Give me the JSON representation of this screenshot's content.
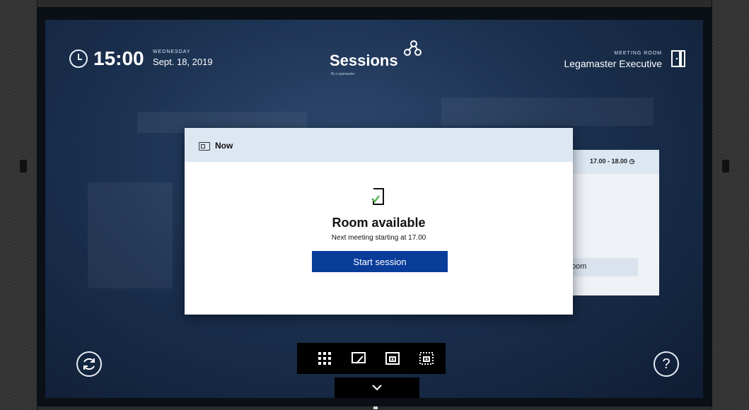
{
  "header": {
    "time": "15:00",
    "day": "WEDNESDAY",
    "date": "Sept. 18, 2019",
    "brand": "Sessions",
    "brand_sub": "By Legamaster",
    "room_label": "MEETING ROOM",
    "room_name": "Legamaster Executive"
  },
  "background_card": {
    "time_range": "17.00 - 18.00",
    "button_fragment": "oom"
  },
  "modal": {
    "header_label": "Now",
    "title": "Room available",
    "subtitle": "Next meeting starting at 17.00",
    "button_label": "Start session"
  },
  "footer": {
    "help_label": "?",
    "tools": [
      "apps-grid-icon",
      "whiteboard-icon",
      "screenshot-icon",
      "area-capture-icon"
    ]
  },
  "colors": {
    "accent": "#0a3d9a",
    "modal_header": "#dde7f2",
    "screen_bg": "#1b3150"
  }
}
